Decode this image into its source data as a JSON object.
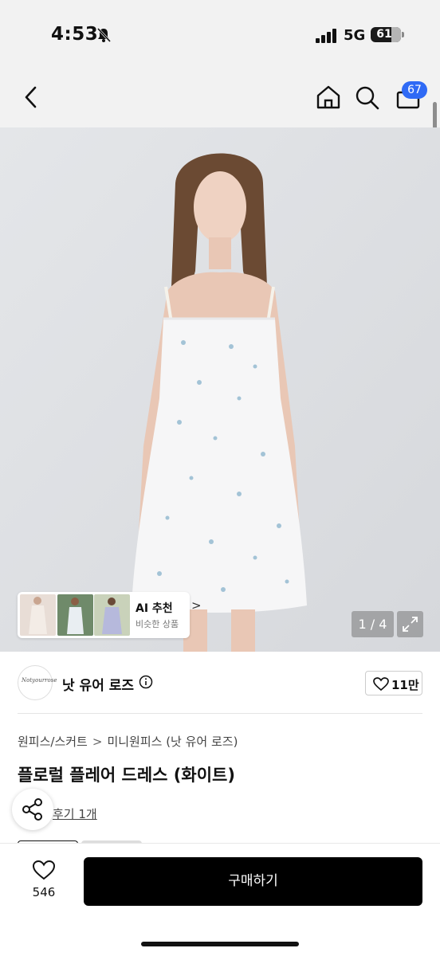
{
  "status_bar": {
    "time": "4:53",
    "network": "5G",
    "battery": "61"
  },
  "header": {
    "cart_count": "67",
    "icons": [
      "back-icon",
      "home-icon",
      "search-icon",
      "shopping-bag-icon"
    ]
  },
  "product_image": {
    "counter": "1 / 4",
    "ai_recommend": {
      "title": "AI 추천",
      "subtitle": "비슷한 상품",
      "chevron": ">"
    }
  },
  "seller": {
    "logo_text": "Notyourrose",
    "name": "낫 유어 로즈",
    "likes": "11만"
  },
  "breadcrumb": {
    "category": "원피스/스커트",
    "separator": ">",
    "subcategory": "미니원피스 (낫 유어 로즈)"
  },
  "product": {
    "title": "플로럴 플레어 드레스 (화이트)",
    "review_link": "후기 1개"
  },
  "bottom_bar": {
    "wish_count": "546",
    "buy_label": "구매하기"
  },
  "colors": {
    "accent_badge": "#2f6af5",
    "buy_button": "#000000",
    "header_bg": "#f2f2f2",
    "image_bg": "#dfe1e4"
  }
}
